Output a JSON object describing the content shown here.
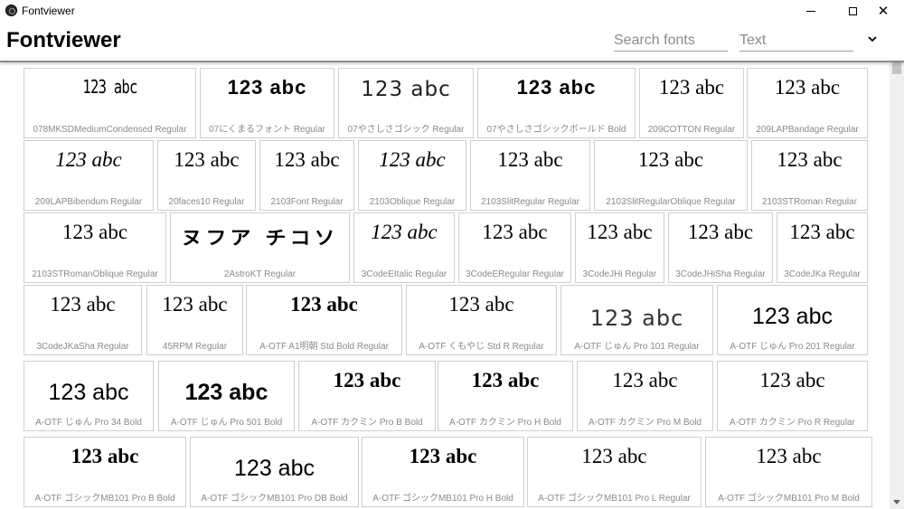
{
  "window": {
    "title": "Fontviewer"
  },
  "header": {
    "app_name": "Fontviewer",
    "search_placeholder": "Search fonts",
    "text_placeholder": "Text"
  },
  "sample_text": "123 abc",
  "rows": [
    {
      "cells": [
        {
          "name": "078MKSDMediumCondensed Regular",
          "style": "cond"
        },
        {
          "name": "07にくまるフォント Regular",
          "style": "sans-bold"
        },
        {
          "name": "07やさしさゴシック Regular",
          "style": "sans-light"
        },
        {
          "name": "07やさしさゴシックボールド Bold",
          "style": "sans-bold"
        },
        {
          "name": "209COTTON Regular",
          "style": "serif"
        },
        {
          "name": "209LAPBandage Regular",
          "style": "serif"
        }
      ]
    },
    {
      "cells": [
        {
          "name": "209LAPBibendum Regular",
          "style": "serif-italic"
        },
        {
          "name": "20faces10 Regular",
          "style": "serif"
        },
        {
          "name": "2103Font Regular",
          "style": "serif"
        },
        {
          "name": "2103Oblique Regular",
          "style": "serif-italic"
        },
        {
          "name": "2103SlitRegular Regular",
          "style": "serif"
        },
        {
          "name": "2103SlitRegularOblique Regular",
          "style": "serif"
        },
        {
          "name": "2103STRoman Regular",
          "style": "serif"
        }
      ]
    },
    {
      "cells": [
        {
          "name": "2103STRomanOblique Regular",
          "style": "serif"
        },
        {
          "name": "2AstroKT Regular",
          "style": "display",
          "sample": "ヌフア チコソ"
        },
        {
          "name": "3CodeEItalic Regular",
          "style": "serif-italic"
        },
        {
          "name": "3CodeERegular Regular",
          "style": "serif"
        },
        {
          "name": "3CodeJHi Regular",
          "style": "serif"
        },
        {
          "name": "3CodeJHiSha Regular",
          "style": "serif"
        },
        {
          "name": "3CodeJKa Regular",
          "style": "serif"
        }
      ]
    },
    {
      "cells": [
        {
          "name": "3CodeJKaSha Regular",
          "style": "serif"
        },
        {
          "name": "45RPM Regular",
          "style": "serif"
        },
        {
          "name": "A-OTF A1明朝 Std Bold Regular",
          "style": "serif-bold"
        },
        {
          "name": "A-OTF くもやじ Std R Regular",
          "style": "serif"
        },
        {
          "name": "A-OTF じゅん Pro 101 Regular",
          "style": "sans-thin"
        },
        {
          "name": "A-OTF じゅん Pro 201 Regular",
          "style": "sans-big"
        }
      ]
    },
    {
      "cells": [
        {
          "name": "A-OTF じゅん Pro 34 Bold",
          "style": "sans-big"
        },
        {
          "name": "A-OTF じゅん Pro 501 Bold",
          "style": "sans-big-bold"
        },
        {
          "name": "A-OTF カクミン Pro B Bold",
          "style": "serif-bold"
        },
        {
          "name": "A-OTF カクミン Pro H Bold",
          "style": "serif-bold"
        },
        {
          "name": "A-OTF カクミン Pro M Bold",
          "style": "serif"
        },
        {
          "name": "A-OTF カクミン Pro R Regular",
          "style": "serif"
        }
      ]
    },
    {
      "cells": [
        {
          "name": "A-OTF ゴシックMB101 Pro B Bold",
          "style": "serif-bold"
        },
        {
          "name": "A-OTF ゴシックMB101 Pro DB Bold",
          "style": "sans-big"
        },
        {
          "name": "A-OTF ゴシックMB101 Pro H Bold",
          "style": "serif-bold"
        },
        {
          "name": "A-OTF ゴシックMB101 Pro L Regular",
          "style": "serif"
        },
        {
          "name": "A-OTF ゴシックMB101 Pro M Bold",
          "style": "serif"
        }
      ]
    }
  ]
}
